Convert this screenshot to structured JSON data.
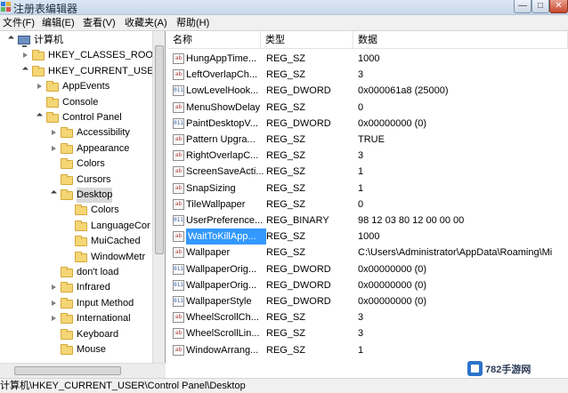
{
  "window": {
    "title": "注册表编辑器",
    "min_glyph": "—",
    "max_glyph": "□",
    "close_glyph": "✕"
  },
  "menu": [
    "文件(F)",
    "编辑(E)",
    "查看(V)",
    "收藏夹(A)",
    "帮助(H)"
  ],
  "tree": [
    {
      "label": "计算机",
      "icon": "computer-icon",
      "state": "expanded"
    },
    {
      "label": "HKEY_CLASSES_ROOT",
      "icon": "folder-icon",
      "state": "collapsed"
    },
    {
      "label": "HKEY_CURRENT_USER",
      "icon": "folder-icon",
      "state": "expanded"
    },
    {
      "label": "AppEvents",
      "icon": "folder-icon",
      "state": "collapsed"
    },
    {
      "label": "Console",
      "icon": "folder-icon",
      "state": "none"
    },
    {
      "label": "Control Panel",
      "icon": "folder-icon",
      "state": "expanded"
    },
    {
      "label": "Accessibility",
      "icon": "folder-icon",
      "state": "collapsed"
    },
    {
      "label": "Appearance",
      "icon": "folder-icon",
      "state": "collapsed"
    },
    {
      "label": "Colors",
      "icon": "folder-icon",
      "state": "none"
    },
    {
      "label": "Cursors",
      "icon": "folder-icon",
      "state": "none"
    },
    {
      "label": "Desktop",
      "icon": "folder-icon",
      "state": "expanded",
      "selected": true
    },
    {
      "label": "Colors",
      "icon": "folder-icon",
      "state": "none"
    },
    {
      "label": "LanguageCor",
      "icon": "folder-icon",
      "state": "none"
    },
    {
      "label": "MuiCached",
      "icon": "folder-icon",
      "state": "none"
    },
    {
      "label": "WindowMetr",
      "icon": "folder-icon",
      "state": "none"
    },
    {
      "label": "don't load",
      "icon": "folder-icon",
      "state": "none"
    },
    {
      "label": "Infrared",
      "icon": "folder-icon",
      "state": "collapsed"
    },
    {
      "label": "Input Method",
      "icon": "folder-icon",
      "state": "collapsed"
    },
    {
      "label": "International",
      "icon": "folder-icon",
      "state": "collapsed"
    },
    {
      "label": "Keyboard",
      "icon": "folder-icon",
      "state": "none"
    },
    {
      "label": "Mouse",
      "icon": "folder-icon",
      "state": "none"
    }
  ],
  "columns": {
    "name": "名称",
    "type": "类型",
    "data": "数据"
  },
  "values": [
    {
      "name": "HungAppTime...",
      "type": "REG_SZ",
      "data": "1000",
      "icon": "string-value-icon"
    },
    {
      "name": "LeftOverlapCh...",
      "type": "REG_SZ",
      "data": "3",
      "icon": "string-value-icon"
    },
    {
      "name": "LowLevelHook...",
      "type": "REG_DWORD",
      "data": "0x000061a8 (25000)",
      "icon": "binary-value-icon"
    },
    {
      "name": "MenuShowDelay",
      "type": "REG_SZ",
      "data": "0",
      "icon": "string-value-icon"
    },
    {
      "name": "PaintDesktopV...",
      "type": "REG_DWORD",
      "data": "0x00000000 (0)",
      "icon": "binary-value-icon"
    },
    {
      "name": "Pattern Upgra...",
      "type": "REG_SZ",
      "data": "TRUE",
      "icon": "string-value-icon"
    },
    {
      "name": "RightOverlapC...",
      "type": "REG_SZ",
      "data": "3",
      "icon": "string-value-icon"
    },
    {
      "name": "ScreenSaveActi...",
      "type": "REG_SZ",
      "data": "1",
      "icon": "string-value-icon"
    },
    {
      "name": "SnapSizing",
      "type": "REG_SZ",
      "data": "1",
      "icon": "string-value-icon"
    },
    {
      "name": "TileWallpaper",
      "type": "REG_SZ",
      "data": "0",
      "icon": "string-value-icon"
    },
    {
      "name": "UserPreference...",
      "type": "REG_BINARY",
      "data": "98 12 03 80 12 00 00 00",
      "icon": "binary-value-icon"
    },
    {
      "name": "WaitToKillApp...",
      "type": "REG_SZ",
      "data": "1000",
      "icon": "string-value-icon",
      "selected": true
    },
    {
      "name": "Wallpaper",
      "type": "REG_SZ",
      "data": "C:\\Users\\Administrator\\AppData\\Roaming\\Mi",
      "icon": "string-value-icon"
    },
    {
      "name": "WallpaperOrig...",
      "type": "REG_DWORD",
      "data": "0x00000000 (0)",
      "icon": "binary-value-icon"
    },
    {
      "name": "WallpaperOrig...",
      "type": "REG_DWORD",
      "data": "0x00000000 (0)",
      "icon": "binary-value-icon"
    },
    {
      "name": "WallpaperStyle",
      "type": "REG_DWORD",
      "data": "0x00000000 (0)",
      "icon": "binary-value-icon"
    },
    {
      "name": "WheelScrollCh...",
      "type": "REG_SZ",
      "data": "3",
      "icon": "string-value-icon"
    },
    {
      "name": "WheelScrollLin...",
      "type": "REG_SZ",
      "data": "3",
      "icon": "string-value-icon"
    },
    {
      "name": "WindowArrang...",
      "type": "REG_SZ",
      "data": "1",
      "icon": "string-value-icon"
    }
  ],
  "value_icon_text": {
    "string": "ab",
    "binary": "011"
  },
  "status": "计算机\\HKEY_CURRENT_USER\\Control Panel\\Desktop",
  "watermark": "782手游网"
}
